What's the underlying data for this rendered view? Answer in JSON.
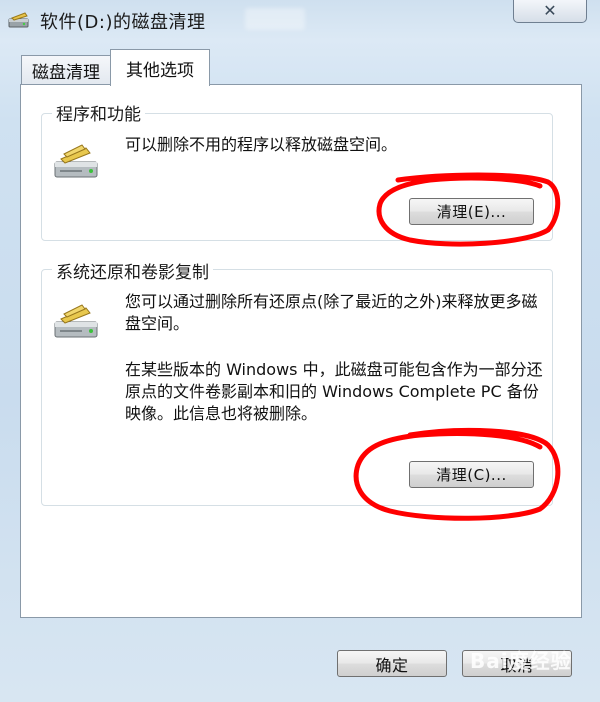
{
  "window": {
    "title": "软件(D:)的磁盘清理",
    "close_label": "✕"
  },
  "tabs": [
    {
      "label": "磁盘清理"
    },
    {
      "label": "其他选项"
    }
  ],
  "programs": {
    "title": "程序和功能",
    "description": "可以删除不用的程序以释放磁盘空间。",
    "button_label": "清理(E)..."
  },
  "restore": {
    "title": "系统还原和卷影复制",
    "description_1": "您可以通过删除所有还原点(除了最近的之外)来释放更多磁盘空间。",
    "description_2": "在某些版本的 Windows 中，此磁盘可能包含作为一部分还原点的文件卷影副本和旧的 Windows Complete PC 备份映像。此信息也将被删除。",
    "button_label": "清理(C)..."
  },
  "footer": {
    "ok_label": "确定",
    "cancel_label": "取消"
  },
  "watermark": "Bai度经验",
  "colors": {
    "annotation": "#ff0000",
    "panel_bg": "#ffffff",
    "frame_bg": "#cfe1f1"
  },
  "icons": {
    "title": "disk-cleanup-icon",
    "group": "hard-drive-icon"
  }
}
